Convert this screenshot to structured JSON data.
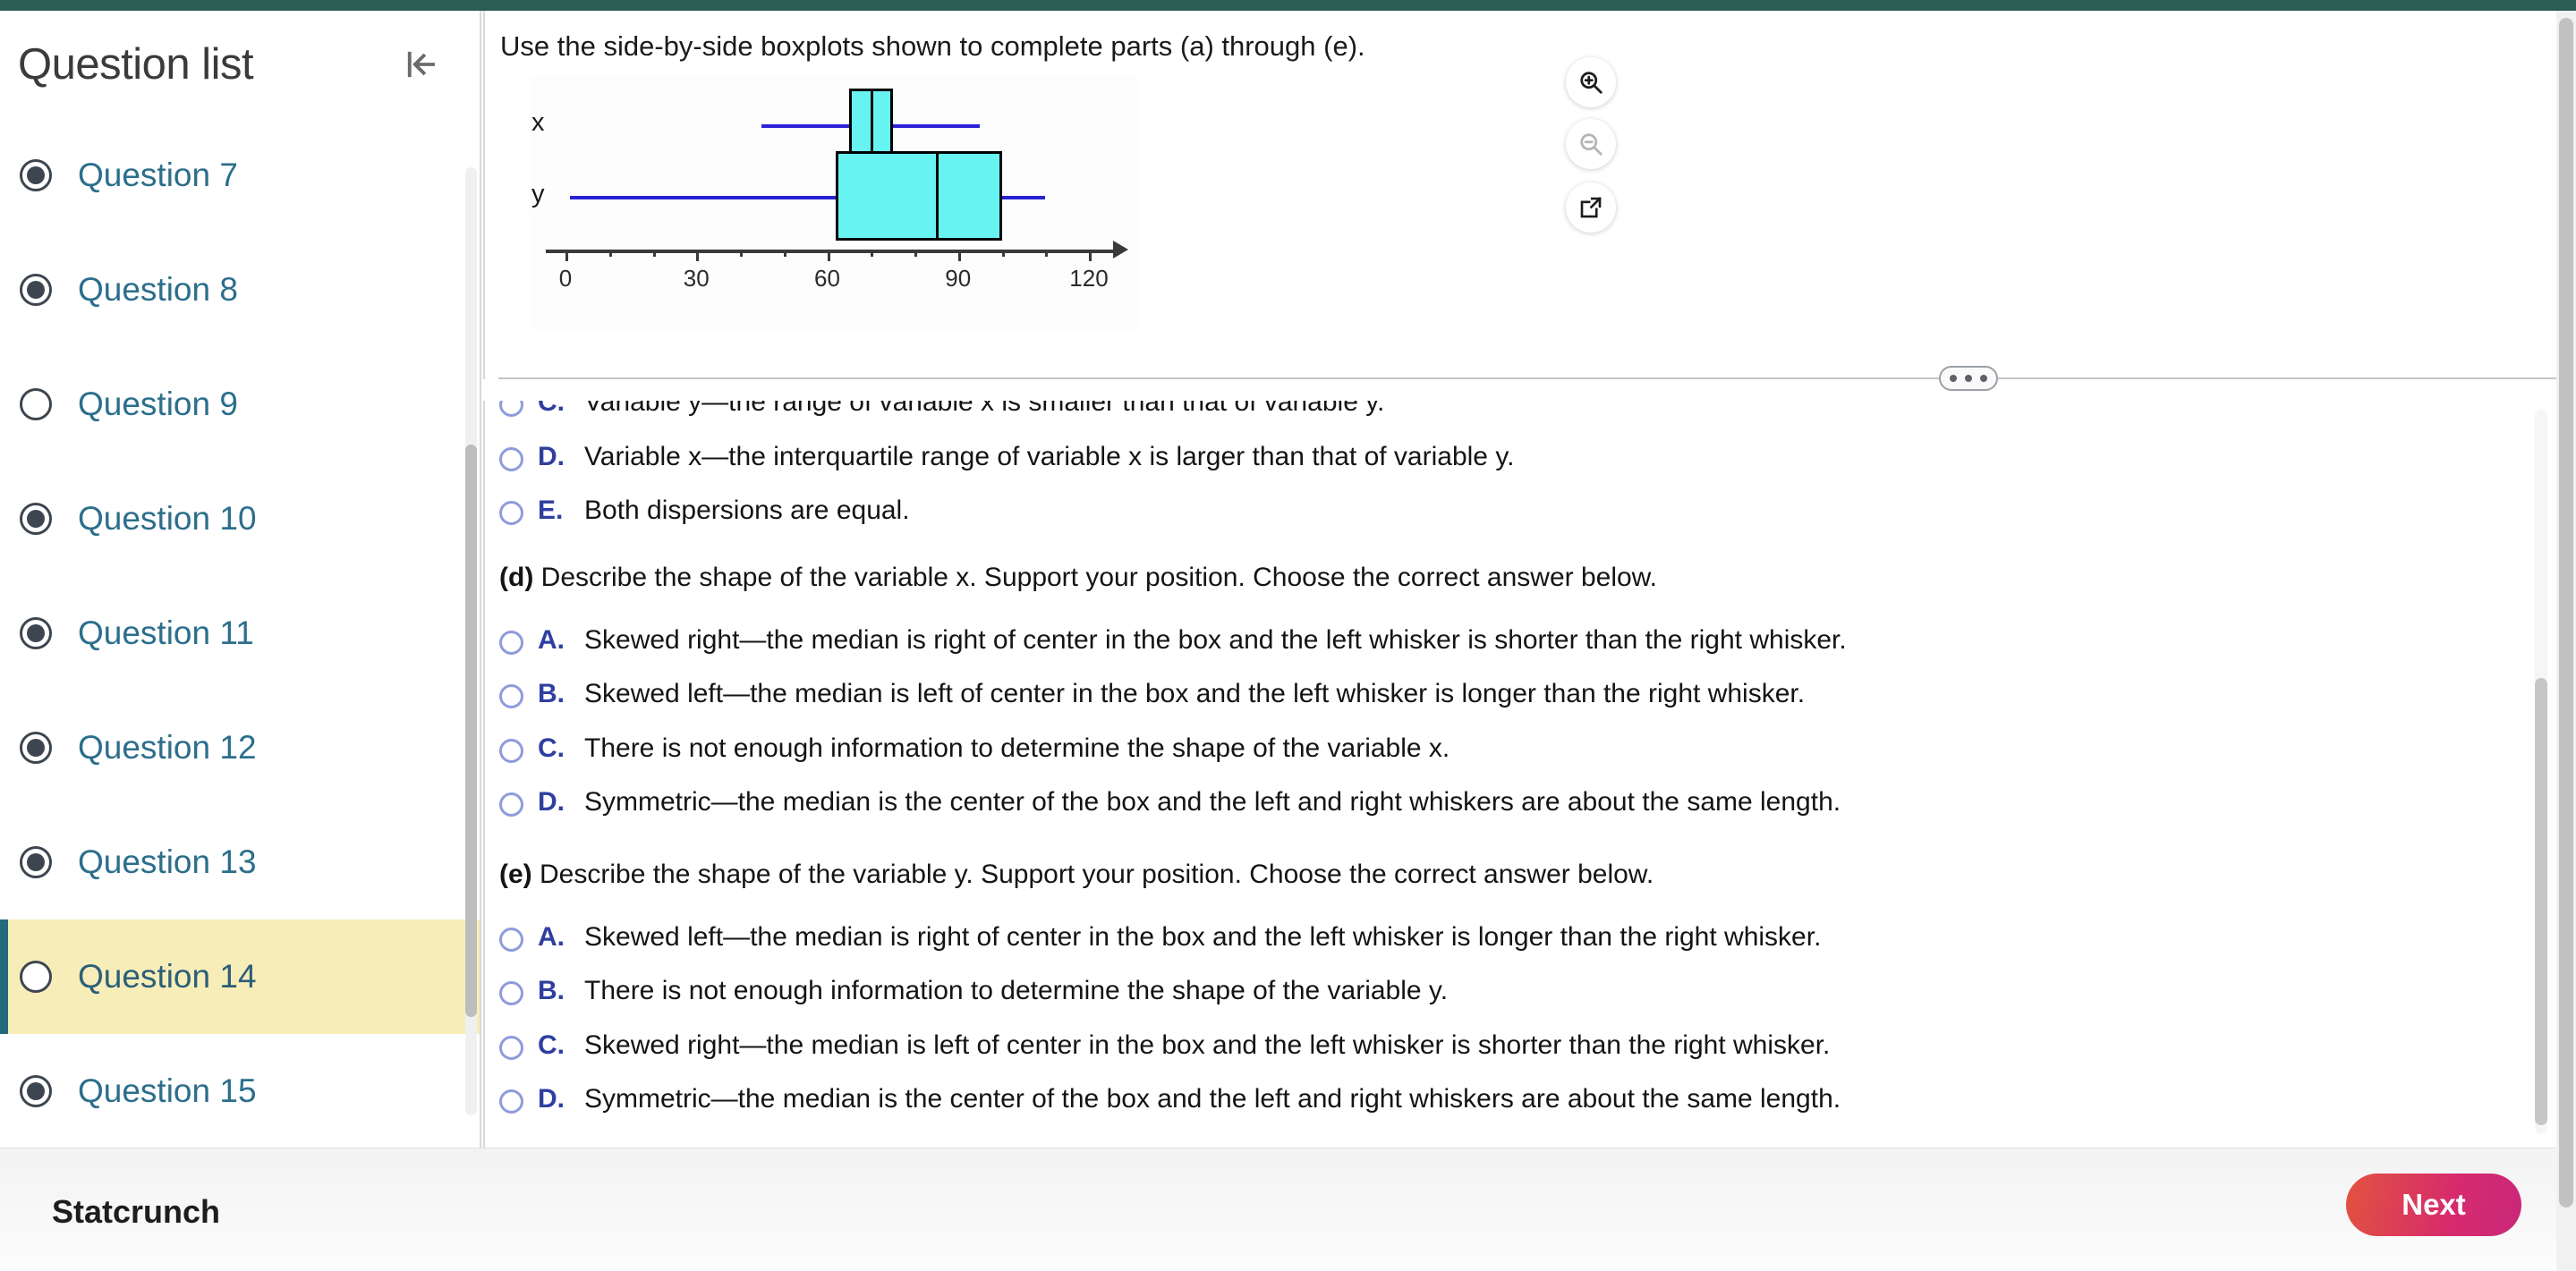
{
  "theme": {
    "accent_bar": "#2b5d55",
    "active_row_bg": "#f7edb9",
    "active_row_border": "#26697d",
    "link_color": "#2c6e8c",
    "option_letter_color": "#2f3fa0",
    "next_gradient_from": "#e2533f",
    "next_gradient_to": "#c9287a",
    "box_fill": "#68f3f3",
    "whisker_color": "#2a21d6"
  },
  "sidebar": {
    "title": "Question list",
    "collapse_icon": "collapse-panel-left-icon",
    "items": [
      {
        "label": "Question 7",
        "answered": true
      },
      {
        "label": "Question 8",
        "answered": true
      },
      {
        "label": "Question 9",
        "answered": false
      },
      {
        "label": "Question 10",
        "answered": true
      },
      {
        "label": "Question 11",
        "answered": true
      },
      {
        "label": "Question 12",
        "answered": true
      },
      {
        "label": "Question 13",
        "answered": true
      },
      {
        "label": "Question 14",
        "answered": false,
        "active": true
      },
      {
        "label": "Question 15",
        "answered": true
      }
    ]
  },
  "figure": {
    "prompt": "Use the side-by-side boxplots shown to complete parts (a) through (e).",
    "tools": [
      {
        "name": "zoom-in-icon",
        "label": "Zoom in",
        "enabled": true
      },
      {
        "name": "zoom-out-icon",
        "label": "Zoom out",
        "enabled": false
      },
      {
        "name": "pop-out-icon",
        "label": "Open in new window",
        "enabled": true
      }
    ]
  },
  "chart_data": {
    "type": "boxplot",
    "title": "",
    "xlabel": "",
    "ylabel": "",
    "xlim": [
      0,
      120
    ],
    "major_ticks": [
      0,
      30,
      60,
      90,
      120
    ],
    "tick_labels": [
      "0",
      "30",
      "60",
      "90",
      "120"
    ],
    "minor_tick_step": 10,
    "grid": false,
    "orientation": "horizontal",
    "legend": "none",
    "series": [
      {
        "name": "x",
        "min": 45,
        "q1": 65,
        "median": 70,
        "q3": 75,
        "max": 95,
        "shape": "symmetric"
      },
      {
        "name": "y",
        "min": 1,
        "q1": 62,
        "median": 85,
        "q3": 100,
        "max": 110,
        "shape": "skewed left"
      }
    ]
  },
  "splitter": {
    "handle_icon": "drag-handle-dots-icon"
  },
  "answers": {
    "clipped_top_option": {
      "letter": "C.",
      "text": "Variable y—the range of variable x is smaller than that of variable y."
    },
    "visible_prev_options": [
      {
        "letter": "D.",
        "text": "Variable x—the interquartile range of variable x is larger than that of variable y."
      },
      {
        "letter": "E.",
        "text": "Both dispersions are equal."
      }
    ],
    "parts": [
      {
        "id": "d",
        "marker": "(d)",
        "heading": "Describe the shape of the variable x. Support your position. Choose the correct answer below.",
        "options": [
          {
            "letter": "A.",
            "text": "Skewed right—the median is right of center in the box and the left whisker is shorter than the right whisker."
          },
          {
            "letter": "B.",
            "text": "Skewed left—the median is left of center in the box and the left whisker is longer than the right whisker."
          },
          {
            "letter": "C.",
            "text": "There is not enough information to determine the shape of the variable x."
          },
          {
            "letter": "D.",
            "text": "Symmetric—the median is the center of the box and the left and right whiskers are about the same length."
          }
        ]
      },
      {
        "id": "e",
        "marker": "(e)",
        "heading": "Describe the shape of the variable y. Support your position. Choose the correct answer below.",
        "options": [
          {
            "letter": "A.",
            "text": "Skewed left—the median is right of center in the box and the left whisker is longer than the right whisker."
          },
          {
            "letter": "B.",
            "text": "There is not enough information to determine the shape of the variable y."
          },
          {
            "letter": "C.",
            "text": "Skewed right—the median is left of center in the box and the left whisker is shorter than the right whisker."
          },
          {
            "letter": "D.",
            "text": "Symmetric—the median is the center of the box and the left and right whiskers are about the same length."
          }
        ]
      }
    ]
  },
  "footer": {
    "brand": "Statcrunch",
    "next_label": "Next"
  }
}
